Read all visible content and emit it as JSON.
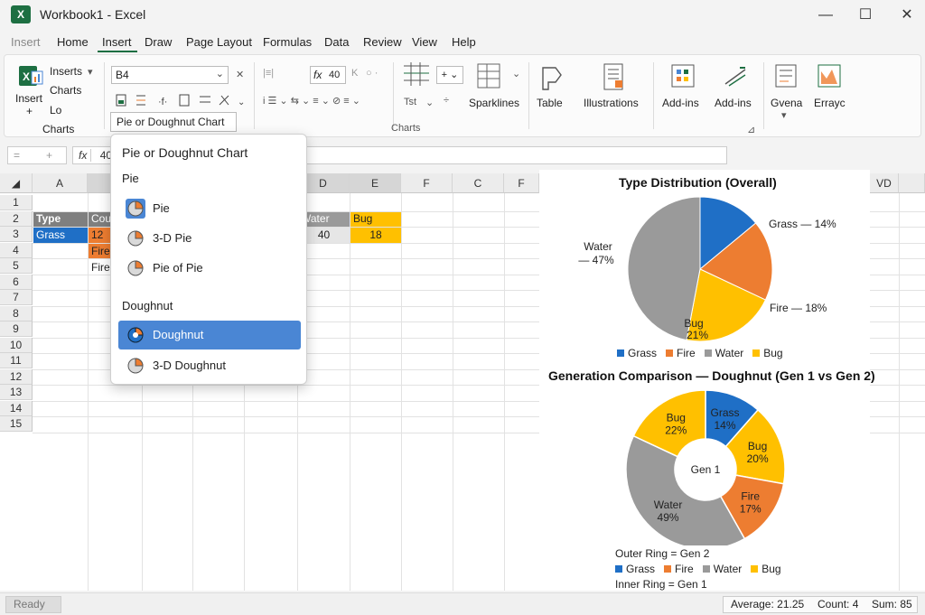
{
  "window": {
    "title": "Workbook1 - Excel",
    "app_letter": "X"
  },
  "menu": [
    "Insert",
    "Home",
    "Insert",
    "Draw",
    "Page Layout",
    "Formulas",
    "Data",
    "Review",
    "View",
    "Help"
  ],
  "ribbon": {
    "insert_label": "Insert",
    "plus": "+",
    "inserts_label": "Inserts",
    "charts_small": "Charts",
    "lo_label": "Lo",
    "group_charts": "Charts",
    "namebox_value": "B4",
    "fx_value": "40",
    "tst": "Tst",
    "sparklines": "Sparklines",
    "table": "Table",
    "illustrations": "Illustrations",
    "addins1": "Add-ins",
    "addins2": "Add-ins",
    "gvena": "Gvena",
    "errayc": "Errayc",
    "group_charts_center": "Charts",
    "tooltip": "Pie or Doughnut Chart"
  },
  "formula_bar": {
    "cell_ref": "=",
    "plus": "+",
    "fx": "fx",
    "value": "40"
  },
  "sheet": {
    "columns": [
      "A",
      "D",
      "E",
      "F",
      "C",
      "F",
      "VD"
    ],
    "rows": [
      "1",
      "2",
      "3",
      "4",
      "5",
      "6",
      "7",
      "8",
      "9",
      "10",
      "11",
      "12",
      "13",
      "14",
      "15"
    ],
    "cells": {
      "a1": "Type",
      "b1": "Cou",
      "d1": "Water",
      "e1": "Bug",
      "a2": "Grass",
      "b2": "12",
      "d2": "40",
      "e2": "18",
      "b3": "Fire",
      "b4": "Fire"
    }
  },
  "dropdown": {
    "title": "Pie or Doughnut Chart",
    "pie_heading": "Pie",
    "pie_items": [
      "Pie",
      "3-D Pie",
      "Pie of Pie"
    ],
    "doughnut_heading": "Doughnut",
    "doughnut_items": [
      "Doughnut",
      "3-D Doughnut"
    ],
    "selected": "Doughnut"
  },
  "chart_data": [
    {
      "type": "pie",
      "title": "Type Distribution (Overall)",
      "categories": [
        "Grass",
        "Fire",
        "Bug",
        "Water"
      ],
      "values": [
        14,
        18,
        21,
        47
      ],
      "labels": [
        "Grass — 14%",
        "Fire — 18%",
        "Bug",
        "21%",
        "Water",
        "— 47%"
      ],
      "legend": [
        "Grass",
        "Fire",
        "Water",
        "Bug"
      ],
      "legend_position": "bottom"
    },
    {
      "type": "doughnut",
      "title": "Generation Comparison — Doughnut (Gen 1 vs Gen 2)",
      "center_label": "Gen 1",
      "categories": [
        "Grass",
        "Bug",
        "Fire",
        "Water",
        "Bug"
      ],
      "values": [
        14,
        20,
        17,
        49,
        22
      ],
      "labels": [
        {
          "name": "Grass",
          "pct": "14%"
        },
        {
          "name": "Bug",
          "pct": "20%"
        },
        {
          "name": "Fire",
          "pct": "17%"
        },
        {
          "name": "Water",
          "pct": "49%"
        },
        {
          "name": "Bug",
          "pct": "22%"
        }
      ],
      "outer_note": "Outer Ring = Gen 2",
      "inner_note": "Inner Ring = Gen 1",
      "legend": [
        "Grass",
        "Fire",
        "Water",
        "Bug"
      ],
      "legend_position": "bottom"
    }
  ],
  "colors": {
    "grass": "#1f6fc6",
    "fire": "#ed7d31",
    "water": "#9a9a9a",
    "bug": "#ffc000",
    "accent": "#4a86d4"
  },
  "status": {
    "ready": "Ready",
    "average": "Average: 21.25",
    "count": "Count: 4",
    "sum": "Sum: 85"
  }
}
